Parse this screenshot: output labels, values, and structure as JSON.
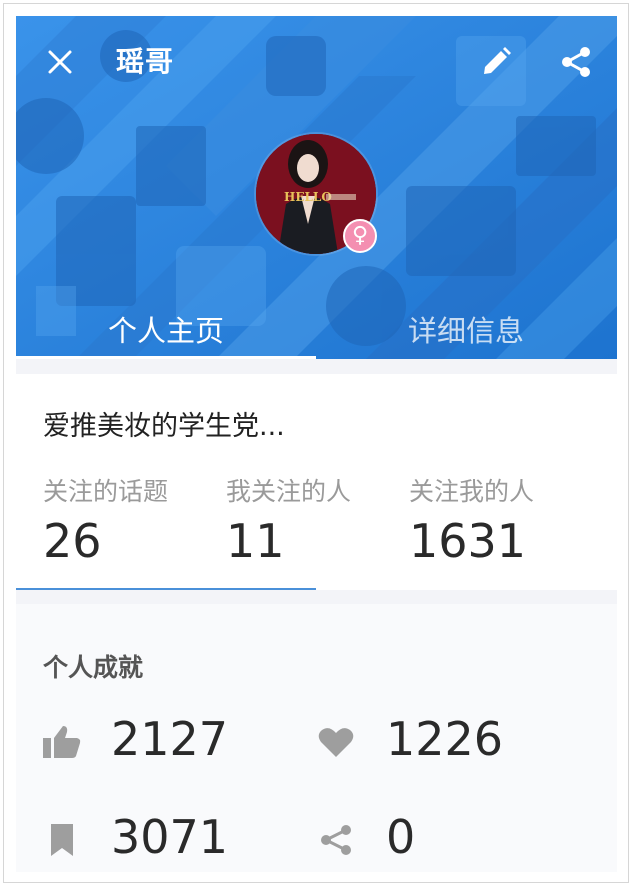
{
  "header": {
    "title": "瑶哥",
    "tabs": [
      {
        "label": "个人主页",
        "active": true
      },
      {
        "label": "详细信息",
        "active": false
      }
    ],
    "accent_color": "#2c86e0"
  },
  "avatar": {
    "image_text": "HELLO",
    "gender_symbol": "♀",
    "gender_color": "#f48fb1"
  },
  "profile": {
    "bio": "爱推美妆的学生党...",
    "stats": [
      {
        "label": "关注的话题",
        "value": "26"
      },
      {
        "label": "我关注的人",
        "value": "11"
      },
      {
        "label": "关注我的人",
        "value": "1631"
      }
    ]
  },
  "achievements": {
    "title": "个人成就",
    "items": [
      {
        "icon": "thumbs-up-icon",
        "value": "2127"
      },
      {
        "icon": "heart-icon",
        "value": "1226"
      },
      {
        "icon": "bookmark-icon",
        "value": "3071"
      },
      {
        "icon": "share-icon",
        "value": "0"
      }
    ]
  }
}
